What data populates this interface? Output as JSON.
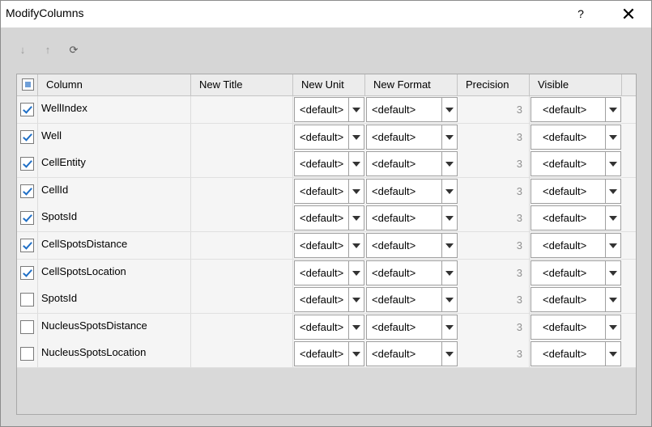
{
  "window": {
    "title": "ModifyColumns",
    "help_label": "?",
    "close_label": "✕"
  },
  "toolbar": {
    "move_down_glyph": "↓",
    "move_up_glyph": "↑",
    "refresh_glyph": "⟳"
  },
  "table": {
    "headers": [
      "Column",
      "New Title",
      "New Unit",
      "New Format",
      "Precision",
      "Visible"
    ],
    "select_all_state": "partial",
    "rows": [
      {
        "checked": true,
        "column": "WellIndex",
        "new_title": "",
        "new_unit": "<default>",
        "new_format": "<default>",
        "precision": "3",
        "visible": "<default>"
      },
      {
        "checked": true,
        "column": "Well",
        "new_title": "",
        "new_unit": "<default>",
        "new_format": "<default>",
        "precision": "3",
        "visible": "<default>"
      },
      {
        "checked": true,
        "column": "CellEntity",
        "new_title": "",
        "new_unit": "<default>",
        "new_format": "<default>",
        "precision": "3",
        "visible": "<default>"
      },
      {
        "checked": true,
        "column": "CellId",
        "new_title": "",
        "new_unit": "<default>",
        "new_format": "<default>",
        "precision": "3",
        "visible": "<default>"
      },
      {
        "checked": true,
        "column": "SpotsId",
        "new_title": "",
        "new_unit": "<default>",
        "new_format": "<default>",
        "precision": "3",
        "visible": "<default>"
      },
      {
        "checked": true,
        "column": "CellSpotsDistance",
        "new_title": "",
        "new_unit": "<default>",
        "new_format": "<default>",
        "precision": "3",
        "visible": "<default>"
      },
      {
        "checked": true,
        "column": "CellSpotsLocation",
        "new_title": "",
        "new_unit": "<default>",
        "new_format": "<default>",
        "precision": "3",
        "visible": "<default>"
      },
      {
        "checked": false,
        "column": "SpotsId",
        "new_title": "",
        "new_unit": "<default>",
        "new_format": "<default>",
        "precision": "3",
        "visible": "<default>"
      },
      {
        "checked": false,
        "column": "NucleusSpotsDistance",
        "new_title": "",
        "new_unit": "<default>",
        "new_format": "<default>",
        "precision": "3",
        "visible": "<default>"
      },
      {
        "checked": false,
        "column": "NucleusSpotsLocation",
        "new_title": "",
        "new_unit": "<default>",
        "new_format": "<default>",
        "precision": "3",
        "visible": "<default>"
      }
    ]
  }
}
